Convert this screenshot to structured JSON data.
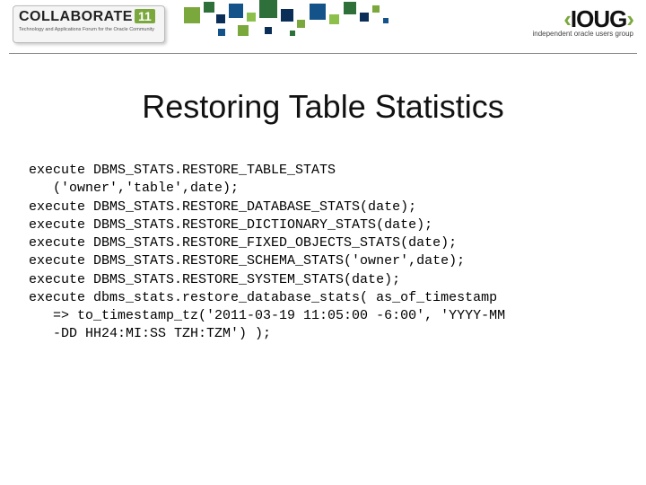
{
  "header": {
    "collab": {
      "title": "COLLABORATE",
      "num": "11",
      "subtitle": "Technology and Applications Forum for the Oracle Community"
    },
    "ioug": {
      "main_open": "‹",
      "main": "IOUG",
      "main_close": "›",
      "subtitle": "independent oracle users group"
    }
  },
  "slide": {
    "title": "Restoring Table Statistics",
    "code_lines": [
      "execute DBMS_STATS.RESTORE_TABLE_STATS",
      "   ('owner','table',date);",
      "execute DBMS_STATS.RESTORE_DATABASE_STATS(date);",
      "execute DBMS_STATS.RESTORE_DICTIONARY_STATS(date);",
      "execute DBMS_STATS.RESTORE_FIXED_OBJECTS_STATS(date);",
      "execute DBMS_STATS.RESTORE_SCHEMA_STATS('owner',date);",
      "execute DBMS_STATS.RESTORE_SYSTEM_STATS(date);",
      "execute dbms_stats.restore_database_stats( as_of_timestamp",
      "   => to_timestamp_tz('2011-03-19 11:05:00 -6:00', 'YYYY-MM",
      "   -DD HH24:MI:SS TZH:TZM') );"
    ]
  }
}
